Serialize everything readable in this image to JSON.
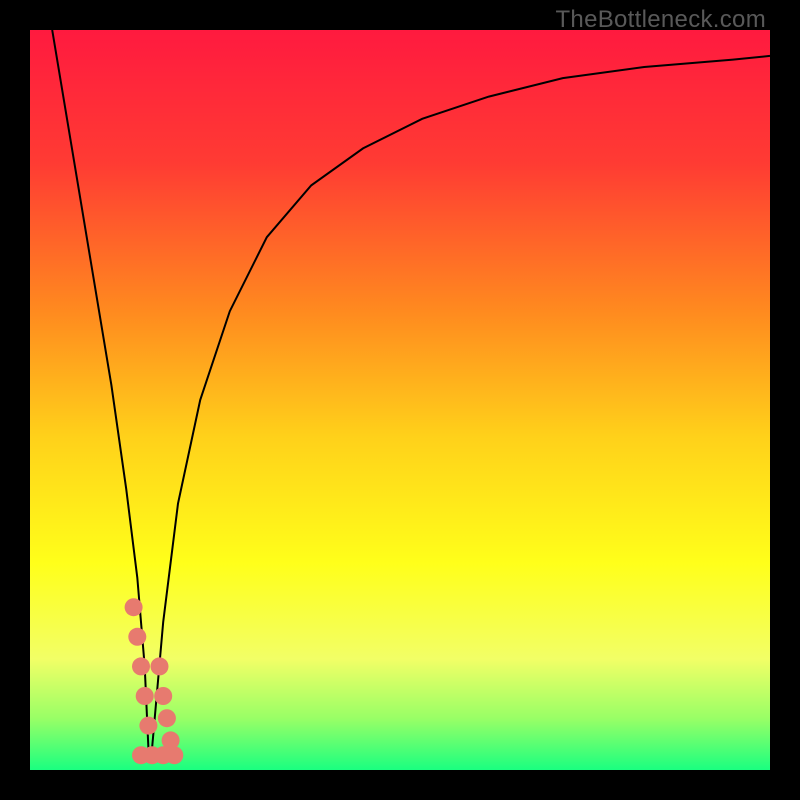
{
  "watermark": "TheBottleneck.com",
  "chart_data": {
    "type": "line",
    "title": "",
    "xlabel": "",
    "ylabel": "",
    "xlim": [
      0,
      100
    ],
    "ylim": [
      0,
      100
    ],
    "grid": false,
    "background_gradient": {
      "stops": [
        {
          "pos": 0.0,
          "color": "#ff1a3f"
        },
        {
          "pos": 0.18,
          "color": "#ff3b33"
        },
        {
          "pos": 0.38,
          "color": "#ff8a1f"
        },
        {
          "pos": 0.55,
          "color": "#ffd11a"
        },
        {
          "pos": 0.72,
          "color": "#ffff1a"
        },
        {
          "pos": 0.85,
          "color": "#f2ff66"
        },
        {
          "pos": 0.93,
          "color": "#99ff66"
        },
        {
          "pos": 1.0,
          "color": "#1aff80"
        }
      ]
    },
    "series": [
      {
        "name": "left-curve",
        "color": "#000000",
        "x": [
          3.0,
          5.0,
          7.0,
          9.0,
          11.0,
          13.0,
          14.5,
          15.5,
          16.0
        ],
        "y": [
          100.0,
          88.0,
          76.0,
          64.0,
          52.0,
          38.0,
          26.0,
          14.0,
          3.0
        ]
      },
      {
        "name": "right-curve",
        "color": "#000000",
        "x": [
          16.5,
          18.0,
          20.0,
          23.0,
          27.0,
          32.0,
          38.0,
          45.0,
          53.0,
          62.0,
          72.0,
          83.0,
          95.0,
          100.0
        ],
        "y": [
          3.0,
          20.0,
          36.0,
          50.0,
          62.0,
          72.0,
          79.0,
          84.0,
          88.0,
          91.0,
          93.5,
          95.0,
          96.0,
          96.5
        ]
      },
      {
        "name": "markers-left",
        "type": "scatter",
        "color": "#e77a6f",
        "x": [
          14.0,
          14.5,
          15.0,
          15.5,
          16.0
        ],
        "y": [
          22.0,
          18.0,
          14.0,
          10.0,
          6.0
        ]
      },
      {
        "name": "markers-right",
        "type": "scatter",
        "color": "#e77a6f",
        "x": [
          17.5,
          18.0,
          18.5,
          19.0
        ],
        "y": [
          14.0,
          10.0,
          7.0,
          4.0
        ]
      },
      {
        "name": "markers-bottom",
        "type": "scatter",
        "color": "#e77a6f",
        "x": [
          15.0,
          16.5,
          18.0,
          19.5
        ],
        "y": [
          2.0,
          2.0,
          2.0,
          2.0
        ]
      }
    ]
  }
}
